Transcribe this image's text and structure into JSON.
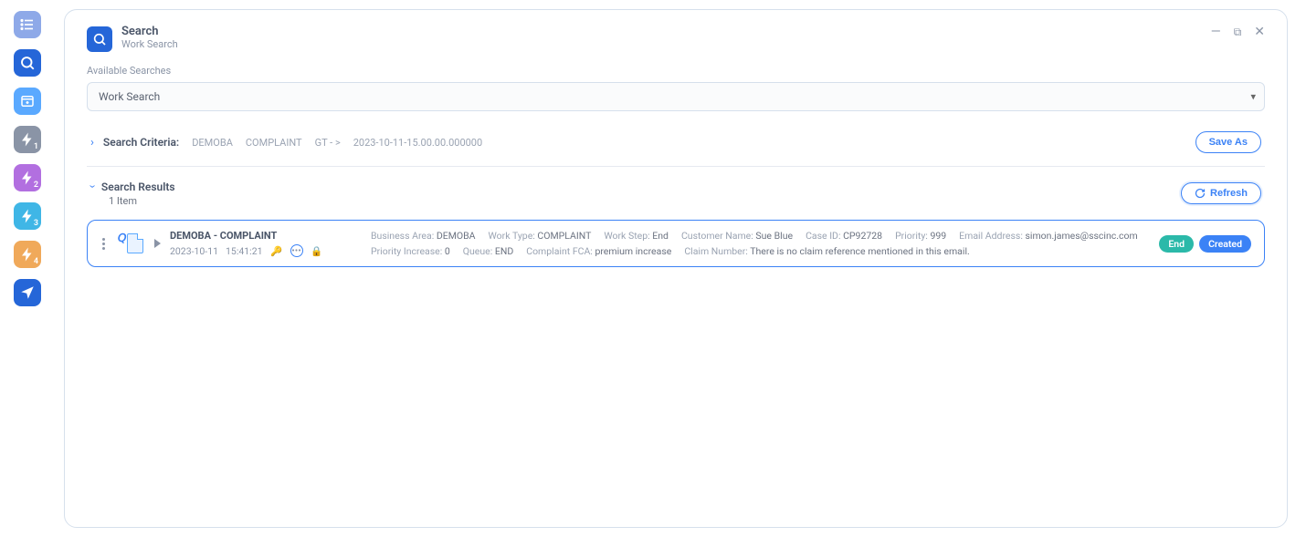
{
  "colors": {
    "primary": "#3b82f6",
    "teal": "#2bb9a9",
    "muted": "#8a94a6"
  },
  "leftRail": {
    "items": [
      {
        "name": "list-icon",
        "bg": "#8ea9e8"
      },
      {
        "name": "search-icon",
        "bg": "#2566d8"
      },
      {
        "name": "add-window-icon",
        "bg": "#5aa9ff"
      },
      {
        "name": "bolt-1-icon",
        "bg": "#8a94a6",
        "sub": "1"
      },
      {
        "name": "bolt-2-icon",
        "bg": "#b26fe0",
        "sub": "2"
      },
      {
        "name": "bolt-3-icon",
        "bg": "#3fb6e6",
        "sub": "3"
      },
      {
        "name": "bolt-4-icon",
        "bg": "#f0a95a",
        "sub": "4"
      },
      {
        "name": "send-icon",
        "bg": "#2566d8"
      }
    ]
  },
  "header": {
    "title": "Search",
    "subtitle": "Work Search"
  },
  "availableSearches": {
    "label": "Available Searches",
    "selected": "Work Search"
  },
  "criteria": {
    "label": "Search Criteria:",
    "chips": [
      "DEMOBA",
      "COMPLAINT",
      "GT - >",
      "2023-10-11-15.00.00.000000"
    ],
    "saveAs": "Save As"
  },
  "results": {
    "title": "Search Results",
    "count": "1 Item",
    "refresh": "Refresh"
  },
  "resultCard": {
    "title": "DEMOBA - COMPLAINT",
    "date": "2023-10-11",
    "time": "15:41:21",
    "fields": [
      {
        "label": "Business Area:",
        "value": "DEMOBA"
      },
      {
        "label": "Work Type:",
        "value": "COMPLAINT"
      },
      {
        "label": "Work Step:",
        "value": "End"
      },
      {
        "label": "Customer Name:",
        "value": "Sue Blue"
      },
      {
        "label": "Case ID:",
        "value": "CP92728"
      },
      {
        "label": "Priority:",
        "value": "999"
      },
      {
        "label": "Email Address:",
        "value": "simon.james@sscinc.com"
      },
      {
        "label": "Priority Increase:",
        "value": "0"
      },
      {
        "label": "Queue:",
        "value": "END"
      },
      {
        "label": "Complaint FCA:",
        "value": "premium increase"
      },
      {
        "label": "Claim Number:",
        "value": "There is no claim reference mentioned in this email."
      }
    ],
    "pills": {
      "end": "End",
      "created": "Created"
    }
  }
}
